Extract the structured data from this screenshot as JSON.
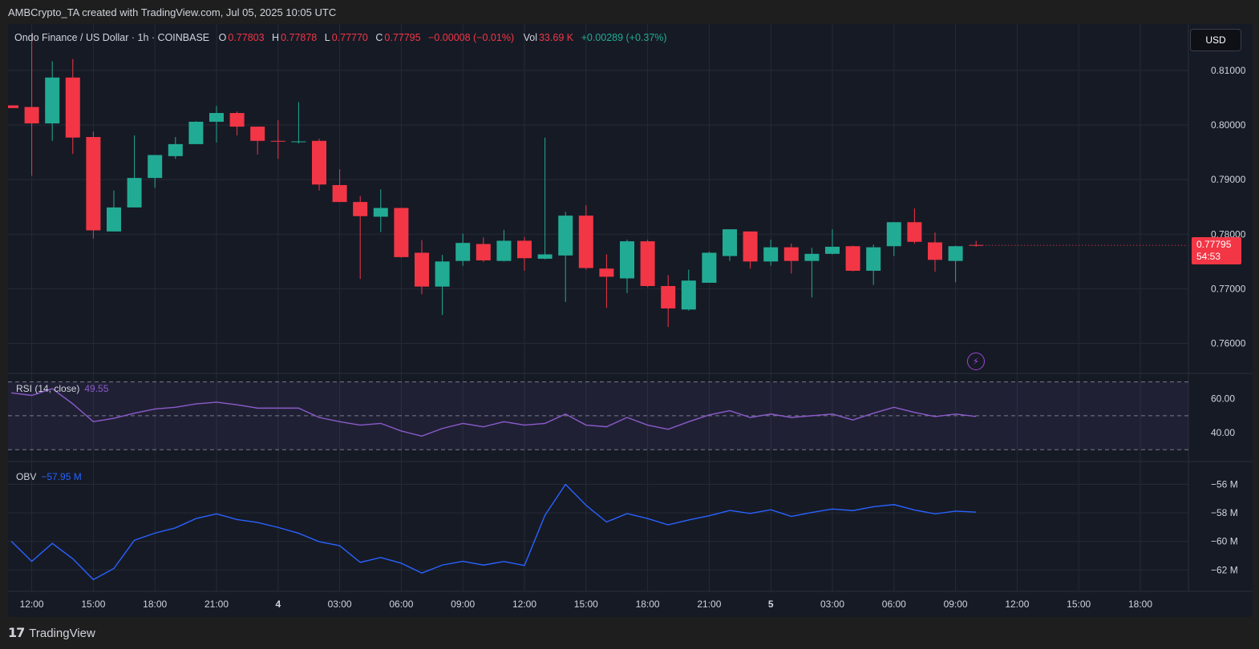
{
  "header": {
    "credit": "AMBCrypto_TA created with TradingView.com, Jul 05, 2025 10:05 UTC"
  },
  "legend": {
    "symbol": "Ondo Finance / US Dollar · 1h · COINBASE",
    "o_label": "O",
    "o_val": "0.77803",
    "h_label": "H",
    "h_val": "0.77878",
    "l_label": "L",
    "l_val": "0.77770",
    "c_label": "C",
    "c_val": "0.77795",
    "change": "−0.00008 (−0.01%)",
    "vol_label": "Vol",
    "vol_val": "33.69 K",
    "extra": "+0.00289 (+0.37%)"
  },
  "currency_button": "USD",
  "price_tag": {
    "price": "0.77795",
    "countdown": "54:53"
  },
  "rsi_pane": {
    "label": "RSI (14, close)",
    "value": "49.55"
  },
  "obv_pane": {
    "label": "OBV",
    "value": "−57.95 M"
  },
  "footer": {
    "brand": "TradingView",
    "logo_icon": "tradingview-logo-icon"
  },
  "colors": {
    "up": "#22ab94",
    "down": "#f23645",
    "rsi": "#8a5cc9",
    "obv": "#2962ff",
    "grid": "#252a35"
  },
  "chart_data": [
    {
      "type": "candlestick",
      "title": "Ondo Finance / US Dollar · 1h · COINBASE",
      "y_ticks": [
        "0.81000",
        "0.80000",
        "0.79000",
        "0.78000",
        "0.77000",
        "0.76000"
      ],
      "ylim": [
        0.7545,
        0.8185
      ],
      "x_ticks": [
        {
          "i": 1,
          "label": "12:00"
        },
        {
          "i": 4,
          "label": "15:00"
        },
        {
          "i": 7,
          "label": "18:00"
        },
        {
          "i": 10,
          "label": "21:00"
        },
        {
          "i": 13,
          "label": "4"
        },
        {
          "i": 16,
          "label": "03:00"
        },
        {
          "i": 19,
          "label": "06:00"
        },
        {
          "i": 22,
          "label": "09:00"
        },
        {
          "i": 25,
          "label": "12:00"
        },
        {
          "i": 28,
          "label": "15:00"
        },
        {
          "i": 31,
          "label": "18:00"
        },
        {
          "i": 34,
          "label": "21:00"
        },
        {
          "i": 37,
          "label": "5"
        },
        {
          "i": 40,
          "label": "03:00"
        },
        {
          "i": 43,
          "label": "06:00"
        },
        {
          "i": 46,
          "label": "09:00"
        },
        {
          "i": 49,
          "label": "12:00"
        },
        {
          "i": 52,
          "label": "15:00"
        },
        {
          "i": 55,
          "label": "18:00"
        }
      ],
      "candles": [
        {
          "o": 0.8036,
          "h": 0.8036,
          "l": 0.8031,
          "c": 0.8031
        },
        {
          "o": 0.8033,
          "h": 0.8168,
          "l": 0.7907,
          "c": 0.8003
        },
        {
          "o": 0.8003,
          "h": 0.8117,
          "l": 0.7971,
          "c": 0.8087
        },
        {
          "o": 0.8087,
          "h": 0.8121,
          "l": 0.7947,
          "c": 0.7977
        },
        {
          "o": 0.7978,
          "h": 0.7988,
          "l": 0.7792,
          "c": 0.7807
        },
        {
          "o": 0.7805,
          "h": 0.788,
          "l": 0.7805,
          "c": 0.7849
        },
        {
          "o": 0.7849,
          "h": 0.7981,
          "l": 0.7849,
          "c": 0.7903
        },
        {
          "o": 0.7903,
          "h": 0.7945,
          "l": 0.7885,
          "c": 0.7945
        },
        {
          "o": 0.7943,
          "h": 0.7978,
          "l": 0.7938,
          "c": 0.7965
        },
        {
          "o": 0.7965,
          "h": 0.8007,
          "l": 0.7965,
          "c": 0.8006
        },
        {
          "o": 0.8006,
          "h": 0.8035,
          "l": 0.7968,
          "c": 0.8022
        },
        {
          "o": 0.8022,
          "h": 0.8025,
          "l": 0.7981,
          "c": 0.7997
        },
        {
          "o": 0.7997,
          "h": 0.7997,
          "l": 0.7946,
          "c": 0.7971
        },
        {
          "o": 0.7971,
          "h": 0.8009,
          "l": 0.7938,
          "c": 0.797
        },
        {
          "o": 0.797,
          "h": 0.8042,
          "l": 0.7966,
          "c": 0.797
        },
        {
          "o": 0.7971,
          "h": 0.7975,
          "l": 0.788,
          "c": 0.7891
        },
        {
          "o": 0.789,
          "h": 0.7919,
          "l": 0.7859,
          "c": 0.7859
        },
        {
          "o": 0.7859,
          "h": 0.787,
          "l": 0.7718,
          "c": 0.7833
        },
        {
          "o": 0.7832,
          "h": 0.7882,
          "l": 0.7804,
          "c": 0.7848
        },
        {
          "o": 0.7848,
          "h": 0.7848,
          "l": 0.7757,
          "c": 0.7758
        },
        {
          "o": 0.7766,
          "h": 0.7789,
          "l": 0.769,
          "c": 0.7704
        },
        {
          "o": 0.7704,
          "h": 0.7762,
          "l": 0.7652,
          "c": 0.775
        },
        {
          "o": 0.7751,
          "h": 0.7801,
          "l": 0.7742,
          "c": 0.7784
        },
        {
          "o": 0.7782,
          "h": 0.7794,
          "l": 0.7749,
          "c": 0.7752
        },
        {
          "o": 0.7751,
          "h": 0.7808,
          "l": 0.775,
          "c": 0.7788
        },
        {
          "o": 0.7788,
          "h": 0.7795,
          "l": 0.7733,
          "c": 0.7756
        },
        {
          "o": 0.7755,
          "h": 0.7977,
          "l": 0.7754,
          "c": 0.7763
        },
        {
          "o": 0.7761,
          "h": 0.7841,
          "l": 0.7676,
          "c": 0.7834
        },
        {
          "o": 0.7834,
          "h": 0.7853,
          "l": 0.7735,
          "c": 0.7738
        },
        {
          "o": 0.7737,
          "h": 0.7763,
          "l": 0.7665,
          "c": 0.7722
        },
        {
          "o": 0.7719,
          "h": 0.779,
          "l": 0.7692,
          "c": 0.7787
        },
        {
          "o": 0.7787,
          "h": 0.779,
          "l": 0.7703,
          "c": 0.7705
        },
        {
          "o": 0.7705,
          "h": 0.7725,
          "l": 0.763,
          "c": 0.7664
        },
        {
          "o": 0.7662,
          "h": 0.7735,
          "l": 0.766,
          "c": 0.7715
        },
        {
          "o": 0.7711,
          "h": 0.7768,
          "l": 0.7711,
          "c": 0.7766
        },
        {
          "o": 0.776,
          "h": 0.7809,
          "l": 0.7751,
          "c": 0.7809
        },
        {
          "o": 0.7805,
          "h": 0.7805,
          "l": 0.7737,
          "c": 0.775
        },
        {
          "o": 0.775,
          "h": 0.779,
          "l": 0.7742,
          "c": 0.7776
        },
        {
          "o": 0.7776,
          "h": 0.7783,
          "l": 0.7728,
          "c": 0.7751
        },
        {
          "o": 0.7751,
          "h": 0.7775,
          "l": 0.7684,
          "c": 0.7764
        },
        {
          "o": 0.7764,
          "h": 0.7809,
          "l": 0.7763,
          "c": 0.7777
        },
        {
          "o": 0.7778,
          "h": 0.7779,
          "l": 0.7732,
          "c": 0.7733
        },
        {
          "o": 0.7733,
          "h": 0.7781,
          "l": 0.7707,
          "c": 0.7776
        },
        {
          "o": 0.7778,
          "h": 0.7822,
          "l": 0.776,
          "c": 0.7822
        },
        {
          "o": 0.7822,
          "h": 0.7847,
          "l": 0.7783,
          "c": 0.7786
        },
        {
          "o": 0.7785,
          "h": 0.7803,
          "l": 0.7731,
          "c": 0.7753
        },
        {
          "o": 0.7751,
          "h": 0.7779,
          "l": 0.7712,
          "c": 0.7778
        },
        {
          "o": 0.77803,
          "h": 0.77878,
          "l": 0.7777,
          "c": 0.77795
        }
      ]
    },
    {
      "type": "line",
      "title": "RSI (14, close)",
      "y_ticks": [
        "60.00",
        "40.00"
      ],
      "ylim": [
        23,
        75
      ],
      "bands": [
        70,
        50,
        30
      ],
      "series": [
        {
          "name": "RSI (14, close)",
          "values": [
            63.5,
            62.0,
            66.0,
            57.0,
            46.5,
            48.5,
            51.5,
            54.0,
            55.0,
            57.0,
            58.0,
            56.5,
            54.5,
            54.5,
            54.5,
            49.0,
            46.5,
            44.5,
            45.5,
            41.0,
            38.0,
            42.5,
            45.5,
            43.5,
            46.5,
            44.5,
            45.5,
            51.0,
            44.5,
            43.5,
            49.0,
            44.5,
            42.0,
            46.5,
            50.5,
            53.0,
            49.0,
            51.0,
            49.0,
            50.0,
            51.0,
            47.5,
            51.5,
            55.0,
            52.0,
            49.5,
            51.0,
            49.55
          ]
        }
      ]
    },
    {
      "type": "line",
      "title": "OBV",
      "y_ticks": [
        "−56 M",
        "−58 M",
        "−60 M",
        "−62 M"
      ],
      "ylim": [
        -63.5,
        -54.4
      ],
      "series": [
        {
          "name": "OBV",
          "values": [
            -59.98,
            -61.4,
            -60.14,
            -61.22,
            -62.68,
            -61.9,
            -59.92,
            -59.42,
            -59.05,
            -58.4,
            -58.07,
            -58.47,
            -58.67,
            -59.02,
            -59.43,
            -60.02,
            -60.3,
            -61.47,
            -61.13,
            -61.53,
            -62.22,
            -61.66,
            -61.4,
            -61.66,
            -61.41,
            -61.69,
            -58.17,
            -56.0,
            -57.47,
            -58.64,
            -58.05,
            -58.4,
            -58.84,
            -58.5,
            -58.2,
            -57.83,
            -58.04,
            -57.78,
            -58.25,
            -57.97,
            -57.73,
            -57.84,
            -57.57,
            -57.42,
            -57.8,
            -58.07,
            -57.88,
            -57.95
          ]
        }
      ]
    }
  ]
}
